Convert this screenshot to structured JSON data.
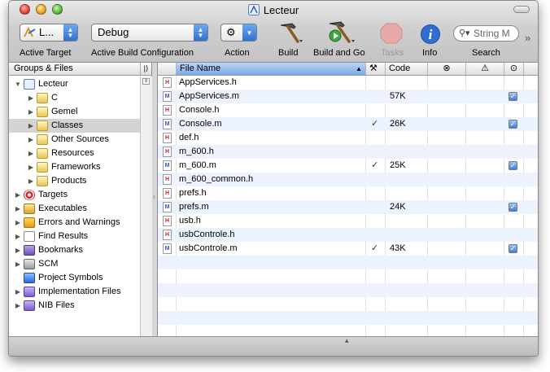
{
  "window": {
    "title": "Lecteur"
  },
  "toolbar": {
    "active_target": {
      "value": "L...",
      "label": "Active Target"
    },
    "active_build_configuration": {
      "value": "Debug",
      "label": "Active Build Configuration"
    },
    "action": {
      "label": "Action"
    },
    "build": {
      "label": "Build"
    },
    "build_and_go": {
      "label": "Build and Go"
    },
    "tasks": {
      "label": "Tasks"
    },
    "info": {
      "label": "Info"
    },
    "search": {
      "placeholder": "String M",
      "label": "Search"
    }
  },
  "groups_panel": {
    "header": "Groups & Files",
    "items": [
      {
        "label": "Lecteur",
        "icon": "project-icon",
        "disclosure": "expanded",
        "level": 0
      },
      {
        "label": "C",
        "icon": "folder-icon",
        "disclosure": "collapsed",
        "level": 1
      },
      {
        "label": "Gemel",
        "icon": "folder-icon",
        "disclosure": "collapsed",
        "level": 1
      },
      {
        "label": "Classes",
        "icon": "folder-icon",
        "disclosure": "collapsed",
        "level": 1,
        "selected": true
      },
      {
        "label": "Other Sources",
        "icon": "folder-icon",
        "disclosure": "collapsed",
        "level": 1
      },
      {
        "label": "Resources",
        "icon": "folder-icon",
        "disclosure": "collapsed",
        "level": 1
      },
      {
        "label": "Frameworks",
        "icon": "folder-icon",
        "disclosure": "collapsed",
        "level": 1
      },
      {
        "label": "Products",
        "icon": "folder-icon",
        "disclosure": "collapsed",
        "level": 1
      },
      {
        "label": "Targets",
        "icon": "targets-icon",
        "disclosure": "collapsed",
        "level": 0
      },
      {
        "label": "Executables",
        "icon": "executables-icon",
        "disclosure": "collapsed",
        "level": 0
      },
      {
        "label": "Errors and Warnings",
        "icon": "warning-icon",
        "disclosure": "collapsed",
        "level": 0
      },
      {
        "label": "Find Results",
        "icon": "find-icon",
        "disclosure": "collapsed",
        "level": 0
      },
      {
        "label": "Bookmarks",
        "icon": "bookmarks-icon",
        "disclosure": "collapsed",
        "level": 0
      },
      {
        "label": "SCM",
        "icon": "scm-icon",
        "disclosure": "collapsed",
        "level": 0
      },
      {
        "label": "Project Symbols",
        "icon": "symbols-icon",
        "disclosure": "none",
        "level": 0
      },
      {
        "label": "Implementation Files",
        "icon": "smart-group-icon",
        "disclosure": "collapsed",
        "level": 0
      },
      {
        "label": "NIB Files",
        "icon": "smart-group-icon",
        "disclosure": "collapsed",
        "level": 0
      }
    ]
  },
  "files_table": {
    "columns": {
      "file_name": "File Name",
      "code": "Code"
    },
    "rows": [
      {
        "type": "h",
        "name": "AppServices.h",
        "built": false,
        "code": "",
        "target": false
      },
      {
        "type": "m",
        "name": "AppServices.m",
        "built": false,
        "code": "57K",
        "target": true
      },
      {
        "type": "h",
        "name": "Console.h",
        "built": false,
        "code": "",
        "target": false
      },
      {
        "type": "m",
        "name": "Console.m",
        "built": true,
        "code": "26K",
        "target": true
      },
      {
        "type": "h",
        "name": "def.h",
        "built": false,
        "code": "",
        "target": false
      },
      {
        "type": "h",
        "name": "m_600.h",
        "built": false,
        "code": "",
        "target": false
      },
      {
        "type": "m",
        "name": "m_600.m",
        "built": true,
        "code": "25K",
        "target": true
      },
      {
        "type": "h",
        "name": "m_600_common.h",
        "built": false,
        "code": "",
        "target": false
      },
      {
        "type": "h",
        "name": "prefs.h",
        "built": false,
        "code": "",
        "target": false
      },
      {
        "type": "m",
        "name": "prefs.m",
        "built": false,
        "code": "24K",
        "target": true
      },
      {
        "type": "h",
        "name": "usb.h",
        "built": false,
        "code": "",
        "target": false
      },
      {
        "type": "h",
        "name": "usbControle.h",
        "built": false,
        "code": "",
        "target": false
      },
      {
        "type": "m",
        "name": "usbControle.m",
        "built": true,
        "code": "43K",
        "target": true
      }
    ]
  }
}
